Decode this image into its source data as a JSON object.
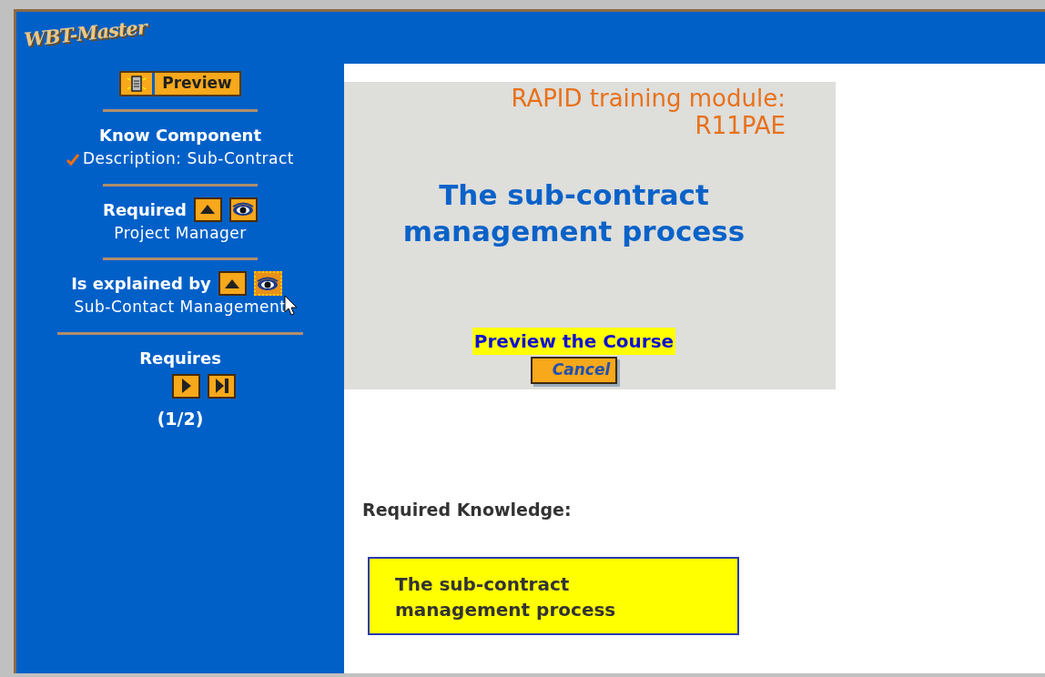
{
  "logo": {
    "text": "WBT-Master"
  },
  "preview_button": {
    "label": "Preview"
  },
  "sidebar": {
    "sections": [
      {
        "heading": "Know Component",
        "items": [
          {
            "text": "Description: Sub-Contract",
            "checked": true
          }
        ]
      },
      {
        "heading": "Required",
        "items": [
          {
            "text": "Project Manager",
            "checked": false
          }
        ],
        "buttons": [
          {
            "kind": "up",
            "focused": false
          },
          {
            "kind": "eye",
            "focused": false
          }
        ]
      },
      {
        "heading": "Is explained by",
        "items": [
          {
            "text": "Sub-Contact Management",
            "checked": false
          }
        ],
        "buttons": [
          {
            "kind": "up",
            "focused": false
          },
          {
            "kind": "eye",
            "focused": true
          }
        ]
      },
      {
        "heading": "Requires",
        "pager": {
          "buttons": [
            {
              "kind": "next"
            },
            {
              "kind": "last"
            }
          ],
          "count": "(1/2)"
        }
      }
    ]
  },
  "module": {
    "label": "RAPID training module:",
    "code": "R11PAE",
    "title": "The sub-contract management process",
    "preview_link": "Preview the Course",
    "cancel_button": "Cancel"
  },
  "required_knowledge": {
    "label": "Required Knowledge:",
    "items": [
      "The sub-contract management process"
    ]
  }
}
